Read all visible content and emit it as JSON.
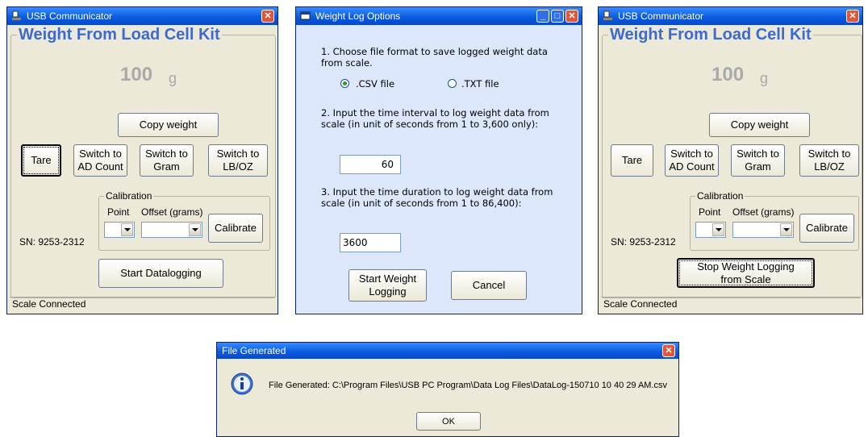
{
  "left_window": {
    "title": "USB Communicator",
    "heading": "Weight From Load Cell Kit",
    "weight_value": "100",
    "weight_unit": "g",
    "copy_weight": "Copy weight",
    "tare": "Tare",
    "switch_ad": "Switch to\nAD Count",
    "switch_gram": "Switch to\nGram",
    "switch_lboz": "Switch to\nLB/OZ",
    "calibration_label": "Calibration",
    "point_label": "Point",
    "offset_label": "Offset (grams)",
    "calibrate": "Calibrate",
    "serial": "SN: 9253-2312",
    "start_logging": "Start Datalogging",
    "status": "Scale Connected"
  },
  "options_window": {
    "title": "Weight Log Options",
    "step1": "1. Choose file format to save logged weight data from scale.",
    "csv_option": ".CSV file",
    "txt_option": ".TXT file",
    "selected_format": "csv",
    "step2": "2. Input the time interval to log weight data from scale (in unit of seconds from 1 to 3,600 only):",
    "interval_value": "60",
    "step3": "3. Input the time duration to log weight data from scale (in unit of seconds from 1 to 86,400):",
    "duration_value": "3600",
    "start_button": "Start Weight\nLogging",
    "cancel_button": "Cancel"
  },
  "right_window": {
    "title": "USB Communicator",
    "heading": "Weight From Load Cell Kit",
    "weight_value": "100",
    "weight_unit": "g",
    "copy_weight": "Copy weight",
    "tare": "Tare",
    "switch_ad": "Switch to\nAD Count",
    "switch_gram": "Switch to\nGram",
    "switch_lboz": "Switch to\nLB/OZ",
    "calibration_label": "Calibration",
    "point_label": "Point",
    "offset_label": "Offset (grams)",
    "calibrate": "Calibrate",
    "serial": "SN: 9253-2312",
    "stop_logging": "Stop Weight Logging\nfrom Scale",
    "status": "Scale Connected"
  },
  "file_dialog": {
    "title": "File Generated",
    "message": "File Generated: C:\\Program Files\\USB PC Program\\Data Log Files\\DataLog-150710 10 40 29 AM.csv",
    "ok_button": "OK"
  },
  "colors": {
    "title_bar": "#0a5ce0",
    "heading": "#3d6ad1",
    "window_face": "#ece9d8",
    "options_body": "#dce7fb",
    "close_button": "#e2553a"
  }
}
